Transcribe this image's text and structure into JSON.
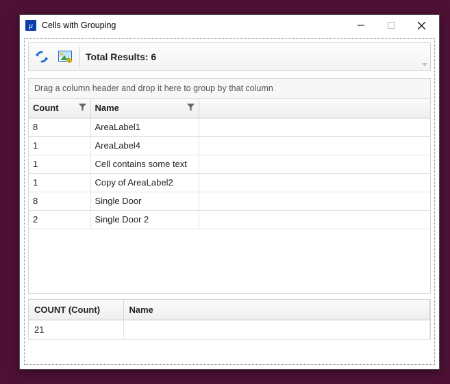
{
  "window": {
    "title": "Cells with Grouping"
  },
  "toolbar": {
    "total_results_prefix": "Total Results: ",
    "total_results_count": "6"
  },
  "group_panel": {
    "hint": "Drag a column header and drop it here to group by that column"
  },
  "columns": {
    "count": "Count",
    "name": "Name"
  },
  "rows": [
    {
      "count": "8",
      "name": "AreaLabel1"
    },
    {
      "count": "1",
      "name": "AreaLabel4"
    },
    {
      "count": "1",
      "name": "Cell contains some text"
    },
    {
      "count": "1",
      "name": "Copy of AreaLabel2"
    },
    {
      "count": "8",
      "name": "Single Door"
    },
    {
      "count": "2",
      "name": "Single Door 2"
    }
  ],
  "footer": {
    "count_header": "COUNT (Count)",
    "name_header": "Name",
    "count_value": "21",
    "name_value": ""
  }
}
